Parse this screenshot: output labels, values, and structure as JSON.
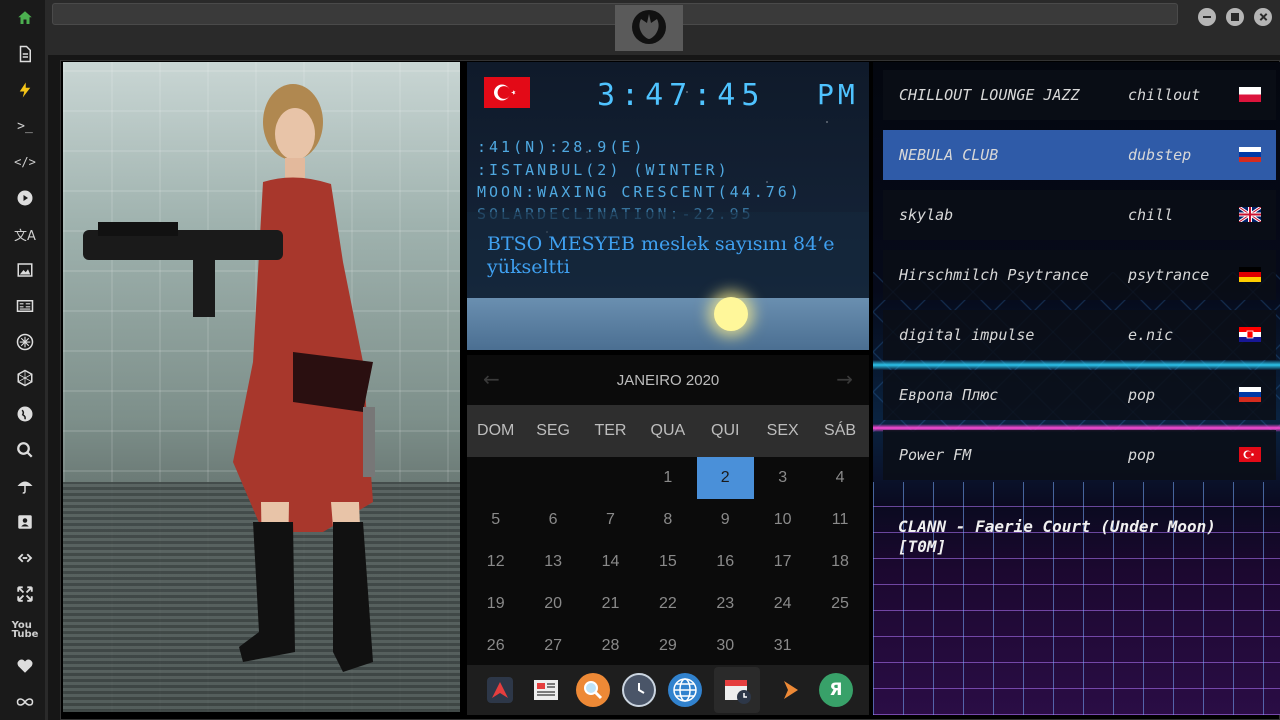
{
  "clock": {
    "time": "3:47:45",
    "ampm": "PM",
    "coords": ":41(N):28.9(E)",
    "location": ":ISTANBUL(2) (WINTER)",
    "moon": "MOON:WAXING CRESCENT(44.76)",
    "solar": "SOLARDECLINATION:-22.95",
    "news": "BTSO MESYEB meslek sayısını 84’e yükseltti"
  },
  "calendar": {
    "month": "JANEIRO 2020",
    "prev_arrow": "←",
    "next_arrow": "→",
    "weekdays": [
      "DOM",
      "SEG",
      "TER",
      "QUA",
      "QUI",
      "SEX",
      "SÁB"
    ],
    "days": [
      "",
      "",
      "",
      "1",
      "2",
      "3",
      "4",
      "5",
      "6",
      "7",
      "8",
      "9",
      "10",
      "11",
      "12",
      "13",
      "14",
      "15",
      "16",
      "17",
      "18",
      "19",
      "20",
      "21",
      "22",
      "23",
      "24",
      "25",
      "26",
      "27",
      "28",
      "29",
      "30",
      "31",
      ""
    ],
    "selected_day": "2"
  },
  "radio": {
    "stations": [
      {
        "name": "CHILLOUT LOUNGE JAZZ",
        "genre": "chillout",
        "flag": "poland"
      },
      {
        "name": "NEBULA CLUB",
        "genre": "dubstep",
        "flag": "russia"
      },
      {
        "name": "skylab",
        "genre": "chill",
        "flag": "uk"
      },
      {
        "name": "Hirschmilch Psytrance",
        "genre": "psytrance",
        "flag": "germany"
      },
      {
        "name": "digital impulse",
        "genre": "e.nic",
        "flag": "croatia"
      },
      {
        "name": "Европа Плюс",
        "genre": "pop",
        "flag": "russia"
      },
      {
        "name": "Power FM",
        "genre": "pop",
        "flag": "turkey"
      }
    ],
    "active_index": 1,
    "now_playing": "CLANN - Faerie Court (Under Moon) [T0M]"
  },
  "sidebar": {
    "icons": [
      "home-icon",
      "document-icon",
      "lightning-icon",
      "terminal-icon",
      "code-icon",
      "play-icon",
      "translate-icon",
      "image-icon",
      "news-icon",
      "star-emblem-icon",
      "hexagon-icon",
      "globe-icon",
      "search-icon",
      "umbrella-icon",
      "contact-card-icon",
      "link-icon",
      "expand-icon",
      "youtube-icon",
      "heart-icon",
      "infinity-icon"
    ]
  },
  "dock": {
    "icons": [
      "arrow-up-app-icon",
      "news-app-icon",
      "search-app-icon",
      "clock-app-icon",
      "globe-app-icon",
      "calendar-app-icon",
      "play-app-icon",
      "yandex-app-icon"
    ],
    "yandex_letter": "Я"
  },
  "colors": {
    "accent": "#4a90d9",
    "clock_blue": "#4fc3ff",
    "active_station": "#2f5ba8",
    "home_green": "#4caf50",
    "flash_yellow": "#f5c518"
  }
}
